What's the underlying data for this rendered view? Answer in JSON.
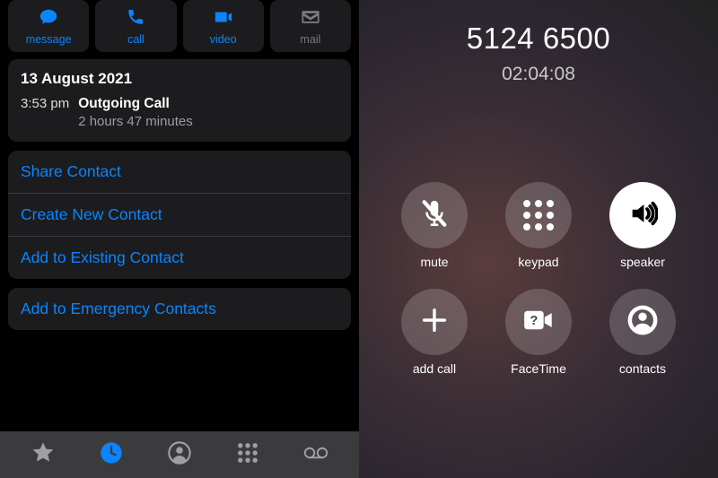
{
  "left": {
    "actions": {
      "message": "message",
      "call": "call",
      "video": "video",
      "mail": "mail"
    },
    "recent": {
      "date": "13 August 2021",
      "time": "3:53 pm",
      "type": "Outgoing Call",
      "duration": "2 hours 47 minutes"
    },
    "options_group1": {
      "share": "Share Contact",
      "create": "Create New Contact",
      "add_existing": "Add to Existing Contact"
    },
    "options_group2": {
      "emergency": "Add to Emergency Contacts"
    },
    "tabs": {
      "favorites": "favorites",
      "recents": "recents",
      "contacts": "contacts",
      "keypad": "keypad",
      "voicemail": "voicemail",
      "active": "recents"
    }
  },
  "right": {
    "number": "5124 6500",
    "elapsed": "02:04:08",
    "buttons": {
      "mute": "mute",
      "keypad": "keypad",
      "speaker": "speaker",
      "add_call": "add call",
      "facetime": "FaceTime",
      "contacts": "contacts"
    },
    "speaker_active": true
  },
  "colors": {
    "accent": "#0a84ff",
    "card": "#1c1c1e"
  }
}
